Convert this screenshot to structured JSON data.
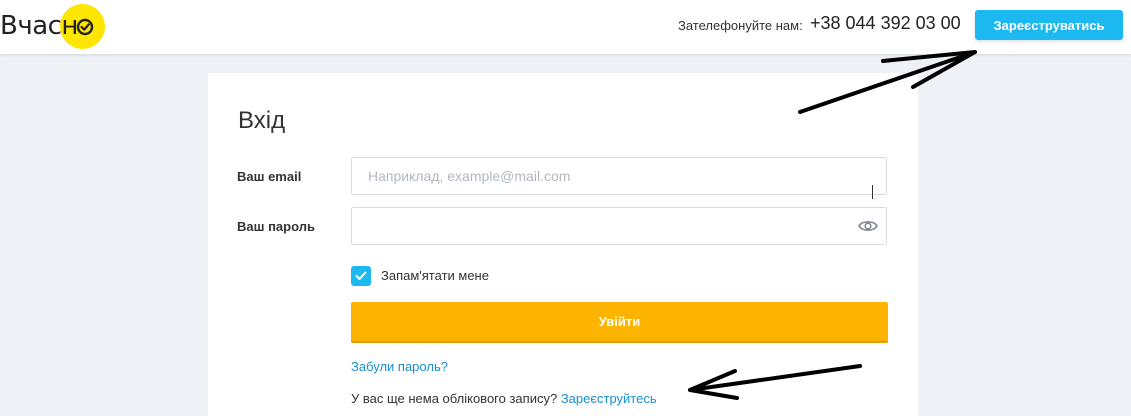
{
  "header": {
    "logo_text": "Вчасн",
    "phone_label": "Зателефонуйте нам:",
    "phone_number": "+38 044 392 03 00",
    "register_button": "Зареєструватись"
  },
  "login": {
    "title": "Вхід",
    "email_label": "Ваш email",
    "email_placeholder": "Наприклад, example@mail.com",
    "email_value": "",
    "password_label": "Ваш пароль",
    "password_value": "",
    "remember_label": "Запам'ятати мене",
    "remember_checked": true,
    "submit_button": "Увійти",
    "forgot_link": "Забули пароль?",
    "no_account_text": "У вас ще нема облікового запису?",
    "register_link": "Зареєструйтесь"
  },
  "colors": {
    "brand_yellow": "#ffe600",
    "accent_blue": "#1cb8f0",
    "submit_orange": "#fdb400",
    "link_blue": "#1a8fcf",
    "page_background": "#eef2f6"
  },
  "icons": {
    "logo": "check-circle-icon",
    "password_toggle": "eye-icon",
    "checkbox": "checkmark-icon"
  }
}
